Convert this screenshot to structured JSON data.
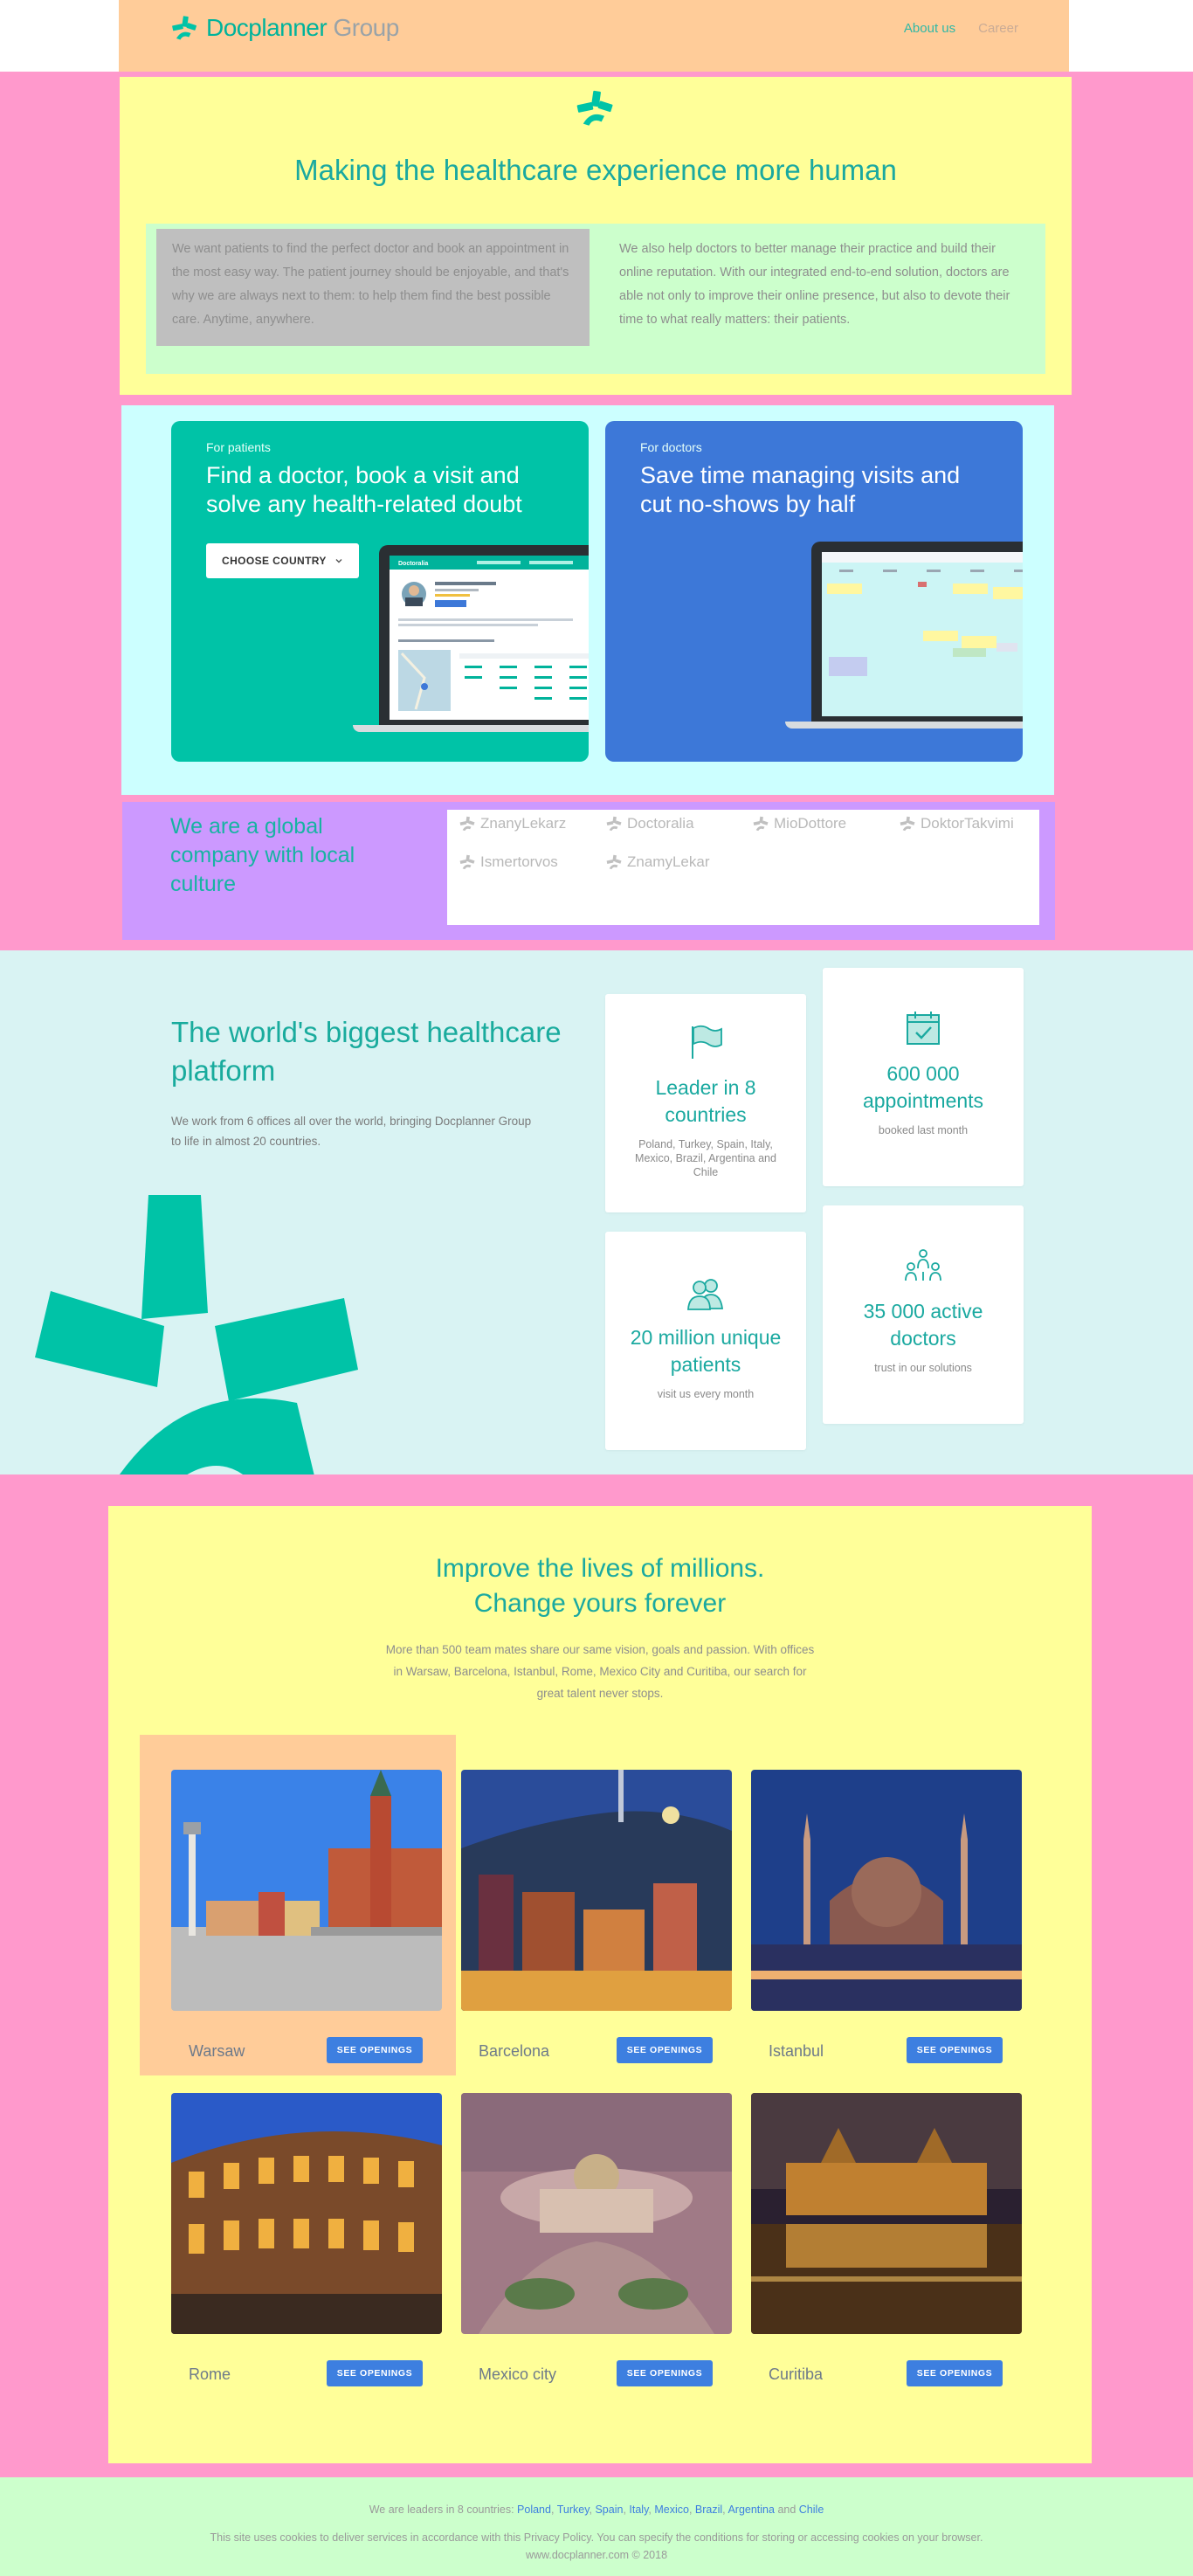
{
  "header": {
    "logo_main": "Docplanner",
    "logo_group": "Group",
    "nav": [
      "About us",
      "Career"
    ]
  },
  "hero": {
    "title": "Making the healthcare experience more human",
    "left_text": "We want patients to find the perfect doctor and book an appointment in the most easy way. The patient journey should be enjoyable, and that's why we are always next to them: to help them find the best possible care. Anytime, anywhere.",
    "right_text": "We also help doctors to better manage their practice and build their online reputation. With our integrated end-to-end solution, doctors are able not only to improve their online presence, but also to devote their time to what really matters: their patients."
  },
  "patients_card": {
    "kicker": "For patients",
    "title": "Find a doctor, book a visit and solve any health-related doubt",
    "button": "CHOOSE COUNTRY",
    "screen_brand": "Doctoralia"
  },
  "doctors_card": {
    "kicker": "For doctors",
    "title": "Save time managing visits and cut no-shows by half"
  },
  "global": {
    "title": "We are a global company with local culture",
    "brands": [
      "ZnanyLekarz",
      "Doctoralia",
      "MioDottore",
      "DoktorTakvimi",
      "Ismertorvos",
      "ZnamyLekar"
    ]
  },
  "platform": {
    "title": "The world's biggest healthcare platform",
    "description": "We work from 6 offices all over the world, bringing Docplanner Group to life in almost 20 countries.",
    "stats": [
      {
        "icon": "flag-icon",
        "value": "Leader in 8 countries",
        "sub": "Poland, Turkey, Spain, Italy, Mexico, Brazil, Argentina and Chile"
      },
      {
        "icon": "calendar-check-icon",
        "value": "600 000 appointments",
        "sub": "booked last month"
      },
      {
        "icon": "users-icon",
        "value": "20 million unique patients",
        "sub": "visit us every month"
      },
      {
        "icon": "doctors-icon",
        "value": "35 000 active doctors",
        "sub": "trust in our solutions"
      }
    ]
  },
  "careers": {
    "title_line1": "Improve the lives of millions.",
    "title_line2": "Change yours forever",
    "description": "More than 500 team mates share our same vision, goals and passion. With offices in Warsaw, Barcelona, Istanbul, Rome, Mexico City and Curitiba, our search for great talent never stops.",
    "button_label": "SEE OPENINGS",
    "cities": [
      "Warsaw",
      "Barcelona",
      "Istanbul",
      "Rome",
      "Mexico city",
      "Curitiba"
    ]
  },
  "footer": {
    "leaders_prefix": "We are leaders in 8 countries:",
    "countries": [
      "Poland",
      "Turkey",
      "Spain",
      "Italy",
      "Mexico",
      "Brazil",
      "Argentina"
    ],
    "and_word": "and",
    "last_country": "Chile",
    "cookies": "This site uses cookies to deliver services in accordance with this Privacy Policy. You can specify the conditions for storing or accessing cookies on your browser.",
    "copyright": "www.docplanner.com © 2018"
  },
  "colors": {
    "brand_teal": "#00c3a7",
    "doctor_blue": "#3d78d8",
    "button_blue": "#3d7fe0"
  }
}
